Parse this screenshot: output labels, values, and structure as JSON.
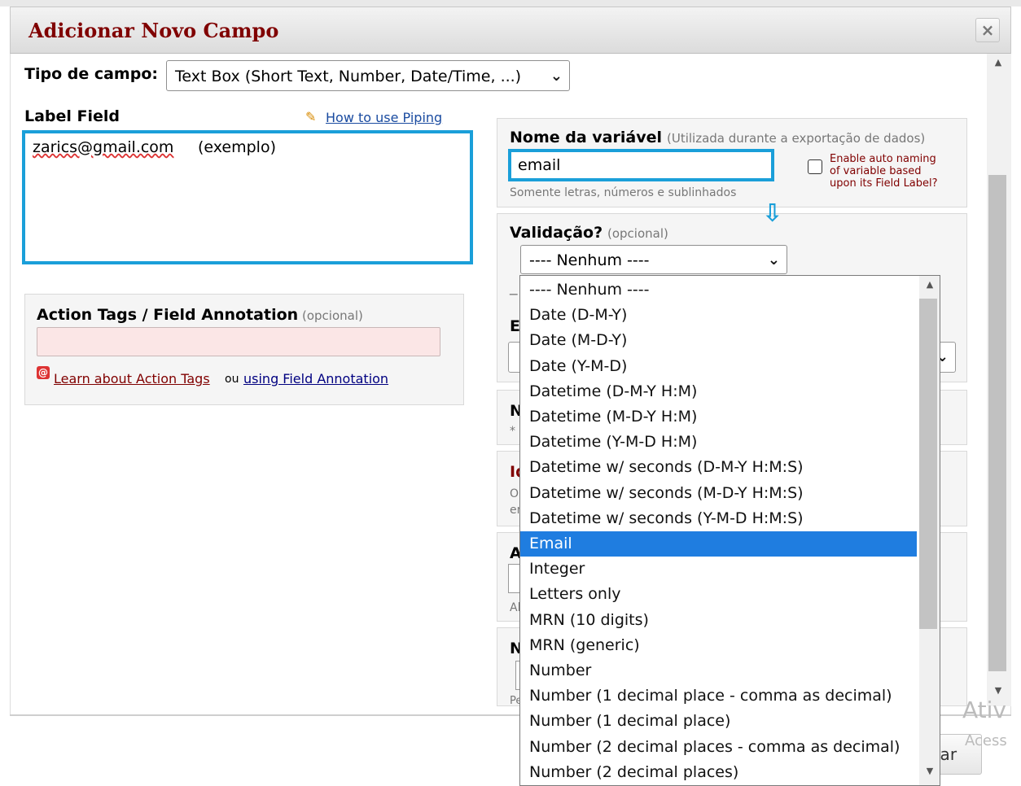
{
  "dialog": {
    "title": "Adicionar Novo Campo",
    "close_icon": "×"
  },
  "field_type": {
    "label": "Tipo de campo:",
    "value": "Text Box (Short Text, Number, Date/Time, ...)"
  },
  "label_field": {
    "label": "Label Field",
    "piping_link": "How to use Piping",
    "value_email": "zarics@gmail.com",
    "value_example": "(exemplo)"
  },
  "action_tags": {
    "label": "Action Tags / Field Annotation",
    "optional": "(opcional)",
    "learn_link": "Learn about Action Tags",
    "or_text": "ou",
    "annotation_link": "using Field Annotation"
  },
  "variable_name": {
    "label": "Nome da variável",
    "hint": "(Utilizada durante a exportação de dados)",
    "value": "email",
    "note": "Somente letras, números e sublinhados",
    "auto_naming_line1": "Enable auto naming",
    "auto_naming_line2": "of variable based",
    "auto_naming_line3": "upon its Field Label?"
  },
  "validation": {
    "label": "Validação?",
    "optional": "(opcional)",
    "selected": "---- Nenhum ----",
    "arrow_icon": "⇩",
    "options": [
      "---- Nenhum ----",
      "Date (D-M-Y)",
      "Date (M-D-Y)",
      "Date (Y-M-D)",
      "Datetime (D-M-Y H:M)",
      "Datetime (M-D-Y H:M)",
      "Datetime (Y-M-D H:M)",
      "Datetime w/ seconds (D-M-Y H:M:S)",
      "Datetime w/ seconds (M-D-Y H:M:S)",
      "Datetime w/ seconds (Y-M-D H:M:S)",
      "Email",
      "Integer",
      "Letters only",
      "MRN (10 digits)",
      "MRN (generic)",
      "Number",
      "Number (1 decimal place - comma as decimal)",
      "Number (1 decimal place)",
      "Number (2 decimal places - comma as decimal)",
      "Number (2 decimal places)"
    ],
    "highlighted": "Email"
  },
  "hidden_fragments": {
    "under_select": "_",
    "e": "E",
    "n1": "N",
    "star": "*",
    "id": "Id",
    "o": "O",
    "en": "en",
    "a": "A",
    "al": "Al",
    "n2": "N",
    "pe": "Pe"
  },
  "footer": {
    "button_fragment": "lar",
    "watermark1": "Ativ",
    "watermark2": "Acess"
  },
  "colors": {
    "title": "#800000",
    "highlight_border": "#1a9fd9",
    "selected_option": "#1f7de0"
  }
}
